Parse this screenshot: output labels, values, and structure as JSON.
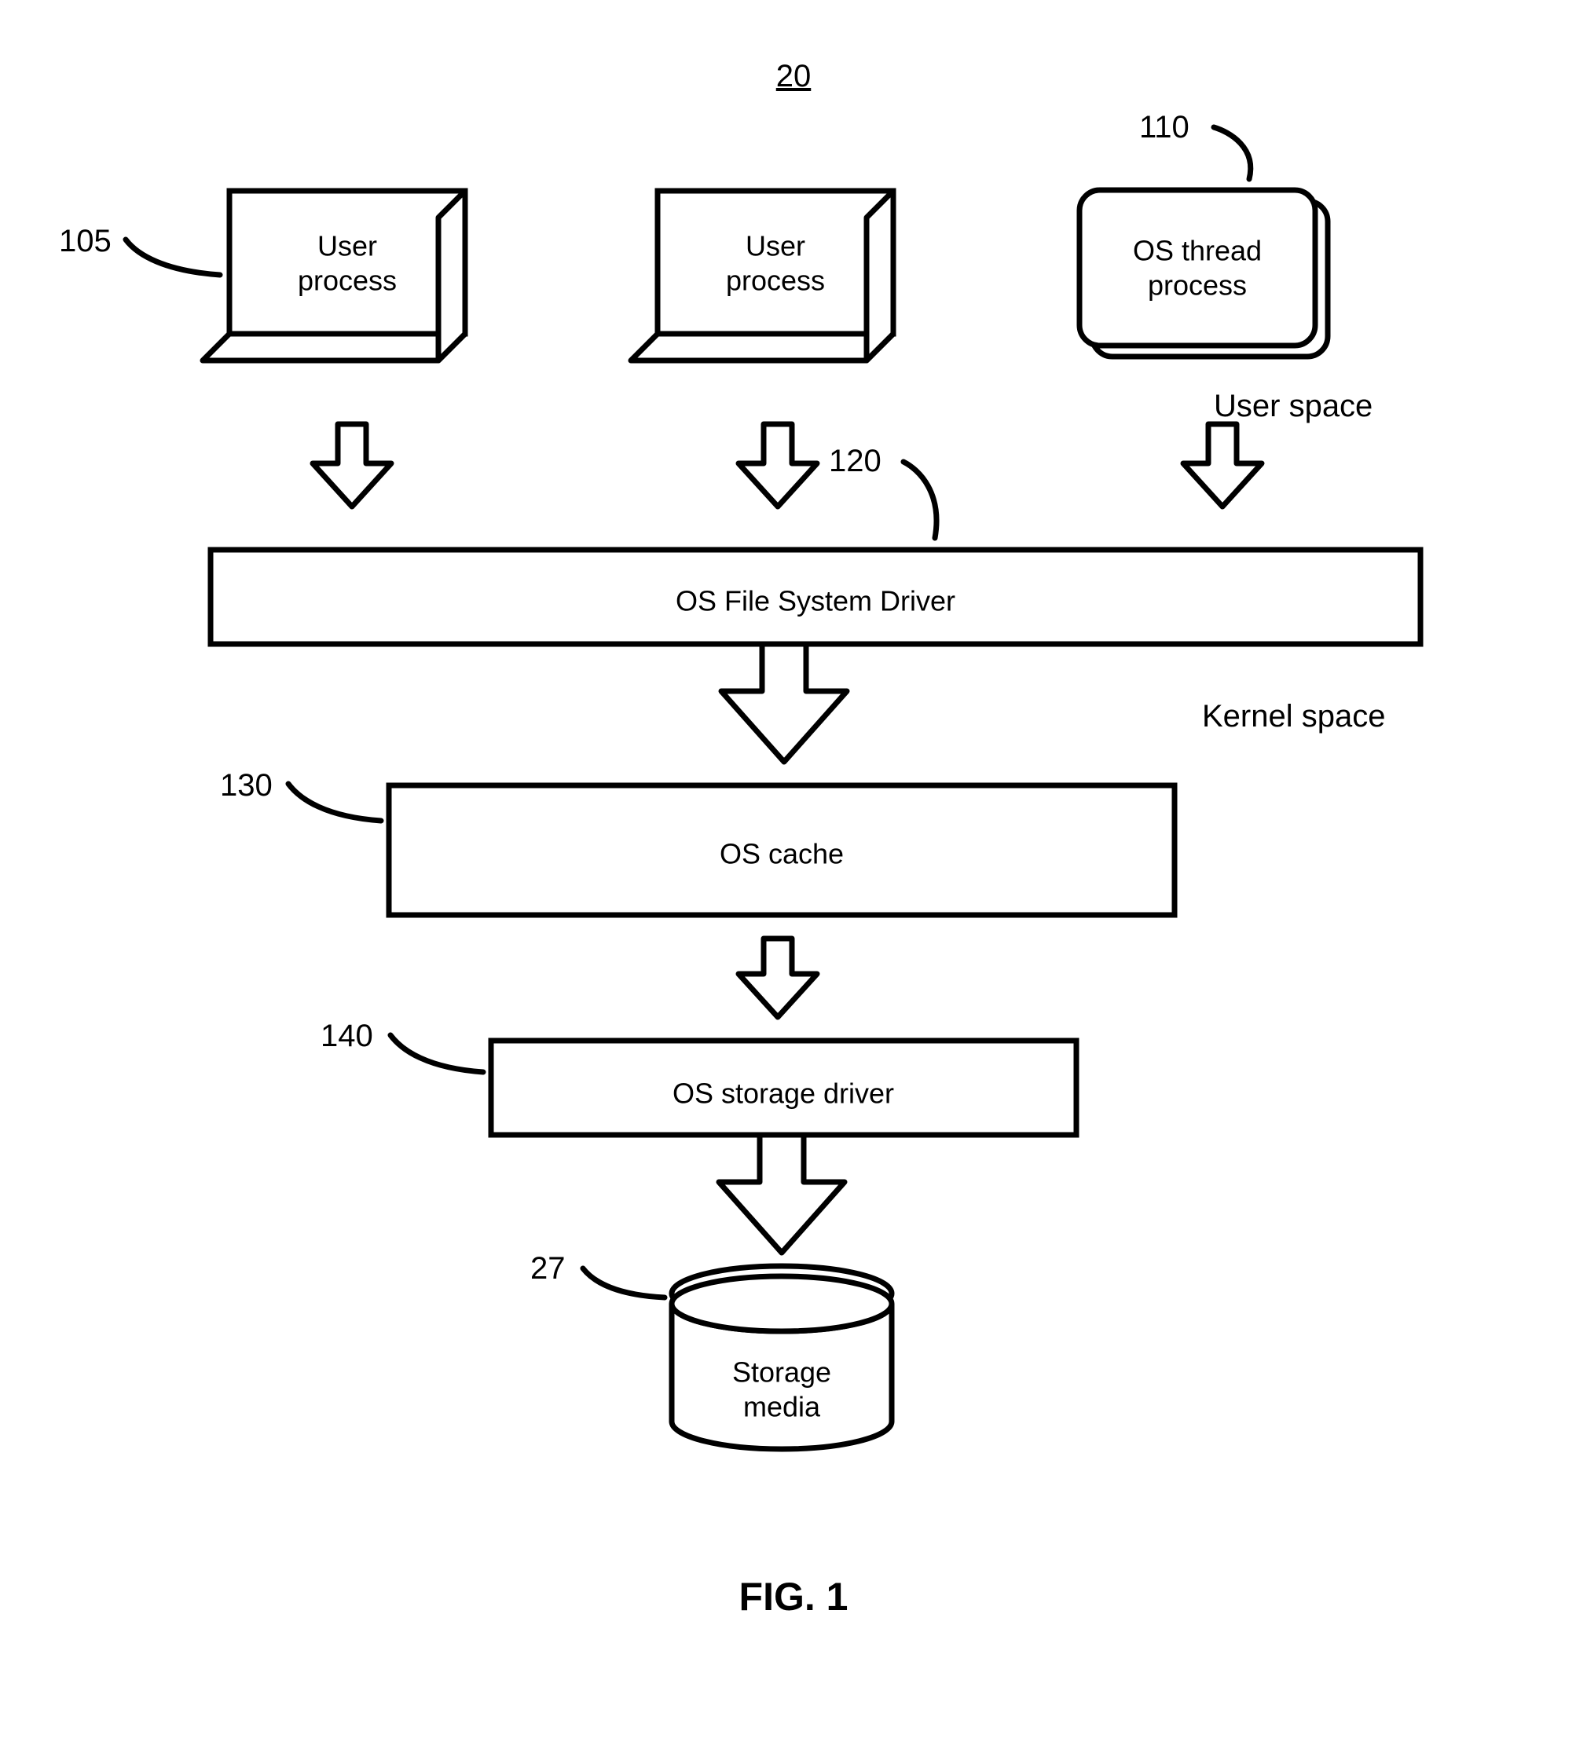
{
  "titleRef": "20",
  "refs": {
    "userProcess": "105",
    "osThread": "110",
    "fsDriver": "120",
    "osCache": "130",
    "storageDriver": "140",
    "storageMedia": "27"
  },
  "labels": {
    "userProcess1a": "User",
    "userProcess1b": "process",
    "userProcess2a": "User",
    "userProcess2b": "process",
    "osThread1": "OS thread",
    "osThread2": "process",
    "userSpace": "User space",
    "kernelSpace": "Kernel space",
    "fsDriver": "OS File System Driver",
    "osCache": "OS cache",
    "storageDriver": "OS storage driver",
    "storageMedia1": "Storage",
    "storageMedia2": "media"
  },
  "figure": "FIG. 1"
}
